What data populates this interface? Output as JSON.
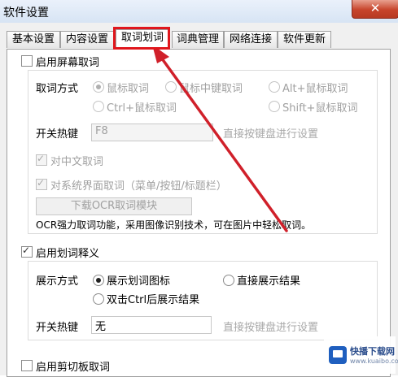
{
  "window": {
    "title": "软件设置",
    "close_glyph": "✕"
  },
  "tabs": [
    {
      "label": "基本设置"
    },
    {
      "label": "内容设置"
    },
    {
      "label": "取词划词"
    },
    {
      "label": "词典管理"
    },
    {
      "label": "网络连接"
    },
    {
      "label": "软件更新"
    }
  ],
  "active_tab": "取词划词",
  "screen_capture": {
    "enable_label": "启用屏幕取词",
    "enabled": false,
    "mode_label": "取词方式",
    "modes": [
      {
        "label": "鼠标取词",
        "selected": true
      },
      {
        "label": "鼠标中键取词",
        "selected": false
      },
      {
        "label": "Alt+鼠标取词",
        "selected": false
      },
      {
        "label": "Ctrl+鼠标取词",
        "selected": false
      },
      {
        "label": "Shift+鼠标取词",
        "selected": false
      }
    ],
    "hotkey_label": "开关热键",
    "hotkey_value": "F8",
    "hotkey_hint": "直接按键盘进行设置",
    "chinese_label": "对中文取词",
    "chinese_checked": true,
    "ui_label": "对系统界面取词（菜单/按钮/标题栏）",
    "ui_checked": true,
    "ocr_button": "下载OCR取词模块",
    "ocr_desc": "OCR强力取词功能，采用图像识别技术，可在图片中轻松取词。"
  },
  "selection": {
    "enable_label": "启用划词释义",
    "enabled": true,
    "display_label": "展示方式",
    "options": [
      {
        "label": "展示划词图标",
        "selected": true
      },
      {
        "label": "直接展示结果",
        "selected": false
      },
      {
        "label": "双击Ctrl后展示结果",
        "selected": false
      }
    ],
    "hotkey_label": "开关热键",
    "hotkey_value": "无",
    "hotkey_hint": "直接按键盘进行设置"
  },
  "clipboard": {
    "enable_label": "启用剪切板取词",
    "enabled": false
  },
  "watermark": {
    "text": "快播下载网",
    "sub": "www.kuaibo.com"
  },
  "colors": {
    "highlight": "#e0161c",
    "arrow": "#d0202a",
    "close_button": "#c7442b"
  },
  "icons": {
    "close": "close-icon",
    "check": "checkmark-icon",
    "arrow": "annotation-arrow"
  }
}
